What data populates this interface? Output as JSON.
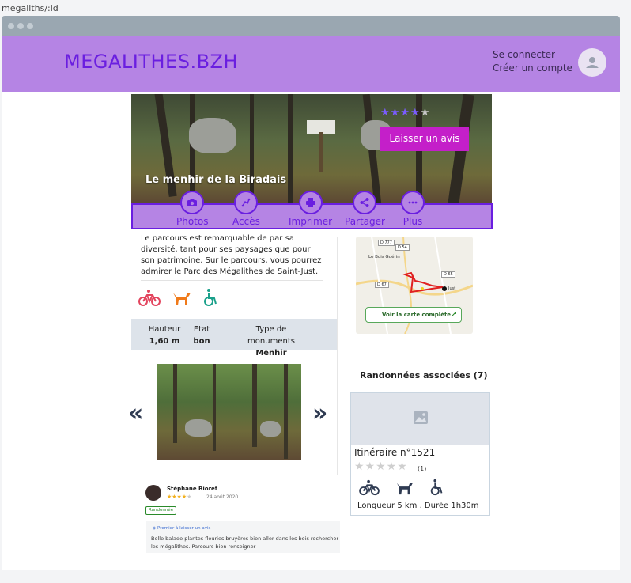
{
  "route": "megaliths/:id",
  "header": {
    "brand": "MEGALITHES.BZH",
    "login": "Se connecter",
    "signup": "Créer un compte"
  },
  "hero": {
    "title": "Le menhir de la Biradais",
    "rating": 4,
    "max_rating": 5,
    "review_button": "Laisser un avis"
  },
  "actions": [
    {
      "label": "Photos",
      "icon": "camera-icon"
    },
    {
      "label": "Accès",
      "icon": "route-icon"
    },
    {
      "label": "Imprimer",
      "icon": "print-icon"
    },
    {
      "label": "Partager",
      "icon": "share-icon"
    },
    {
      "label": "Plus",
      "icon": "more-icon"
    }
  ],
  "description": "Le parcours est remarquable de par sa diversité, tant pour ses paysages que pour son patrimoine. Sur le parcours, vous pourrez admirer le Parc des Mégalithes de Saint-Just.",
  "amenities": [
    "bike-icon",
    "dog-icon",
    "wheelchair-icon"
  ],
  "specs": {
    "height_label": "Hauteur",
    "height_value": "1,60 m",
    "state_label": "Etat",
    "state_value": "bon",
    "type_label": "Type de monuments",
    "type_value": "Menhir"
  },
  "gallery": {
    "prev": "«",
    "next": "»"
  },
  "review": {
    "author": "Stéphane Bioret",
    "rating": 4,
    "date": "24 août 2020",
    "tag": "Randonnée",
    "badge": "Premier à laisser un avis",
    "text": "Belle balade plantes fleuries bruyères bien aller dans les bois rechercher les mégalithes. Parcours bien renseigner"
  },
  "map": {
    "button": "Voir la carte complète",
    "place": "Le Bois Guérin",
    "roads": [
      "D 777",
      "D 54",
      "D 65",
      "D 67"
    ],
    "town": "Just"
  },
  "randos": {
    "title": "Randonnées associées (7)",
    "card": {
      "title": "Itinéraire n°1521",
      "rating_count": "(1)",
      "footer": "Longueur 5 km .  Durée 1h30m"
    }
  },
  "colors": {
    "header_bg": "#b584e4",
    "brand": "#6a1ee0",
    "review_button": "#c41fc9",
    "star": "#7b5cff",
    "amenity_bike": "#e3455e",
    "amenity_dog": "#f07a1a",
    "amenity_wheelchair": "#1aa08a"
  }
}
